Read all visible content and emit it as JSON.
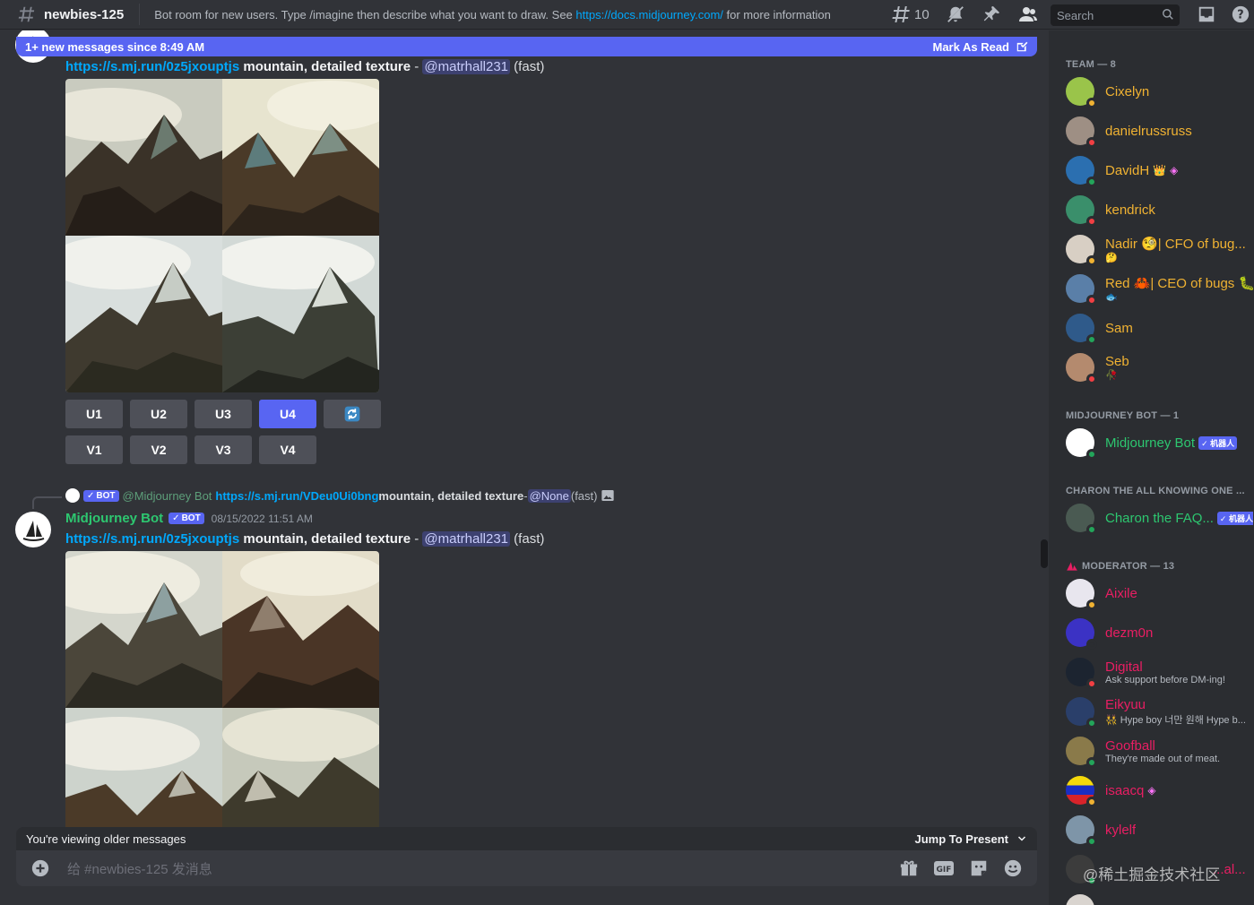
{
  "header": {
    "channel_name": "newbies-125",
    "topic_prefix": "Bot room for new users. Type /imagine then describe what you want to draw. See ",
    "topic_link": "https://docs.midjourney.com/",
    "topic_suffix": " for more information",
    "thread_count": "10",
    "search_placeholder": "Search"
  },
  "new_messages_bar": {
    "text": "1+ new messages since 8:49 AM",
    "action": "Mark As Read"
  },
  "messages": [
    {
      "link": "https://s.mj.run/0z5jxouptjs",
      "prompt": " mountain, detailed texture",
      "sep": " - ",
      "mention": "@matrhall231",
      "speed": " (fast)",
      "upscale_buttons": [
        "U1",
        "U2",
        "U3",
        "U4"
      ],
      "variation_buttons": [
        "V1",
        "V2",
        "V3",
        "V4"
      ]
    },
    {
      "reply": {
        "badge": "BOT",
        "author": "@Midjourney Bot",
        "link": "https://s.mj.run/VDeu0Ui0bng",
        "prompt": " mountain, detailed texture",
        "sep": " - ",
        "mention": "@None",
        "speed": " (fast)"
      },
      "author": "Midjourney Bot",
      "badge": "BOT",
      "timestamp": "08/15/2022 11:51 AM",
      "link": "https://s.mj.run/0z5jxouptjs",
      "prompt": " mountain, detailed texture",
      "sep": " - ",
      "mention": "@matrhall231",
      "speed": " (fast)"
    }
  ],
  "older_bar": {
    "text": "You're viewing older messages",
    "jump": "Jump To Present"
  },
  "composer": {
    "placeholder": "给 #newbies-125 发消息"
  },
  "members": {
    "team_header": "TEAM — 8",
    "team": [
      {
        "name": "Cixelyn",
        "status": "idle",
        "sub": ""
      },
      {
        "name": "danielrussruss",
        "status": "dnd",
        "sub": ""
      },
      {
        "name": "DavidH",
        "status": "online",
        "sub": ""
      },
      {
        "name": "kendrick",
        "status": "dnd",
        "sub": ""
      },
      {
        "name": "Nadir 🧐| CFO of bug...",
        "status": "idle",
        "sub": "🤔"
      },
      {
        "name": "Red 🦀| CEO of bugs 🐛",
        "status": "dnd",
        "sub": "🐟"
      },
      {
        "name": "Sam",
        "status": "online",
        "sub": ""
      },
      {
        "name": "Seb",
        "status": "dnd",
        "sub": "🥀"
      }
    ],
    "bot_header": "MIDJOURNEY BOT — 1",
    "bot": {
      "name": "Midjourney Bot",
      "badge": "✓ 机器人"
    },
    "charon_header": "CHARON THE ALL KNOWING ONE ...",
    "charon": {
      "name": "Charon the FAQ...",
      "badge": "✓ 机器人"
    },
    "mod_header": "MODERATOR — 13",
    "mods": [
      {
        "name": "Aixile",
        "sub": ""
      },
      {
        "name": "dezm0n",
        "sub": ""
      },
      {
        "name": "Digital",
        "sub": "Ask support before DM-ing!"
      },
      {
        "name": "Eikyuu",
        "sub": "👯 Hype boy 너만 원해 Hype b..."
      },
      {
        "name": "Goofball",
        "sub": "They're made out of meat."
      },
      {
        "name": "isaacq",
        "sub": ""
      },
      {
        "name": "kylelf",
        "sub": ""
      }
    ],
    "last_partial": "...al...",
    "watermark": "@稀土掘金技术社区"
  },
  "colors": {
    "accent": "#5865f2",
    "team_name": "#f0b232",
    "bot_name": "#2dc770",
    "mod_name": "#e91e63",
    "link": "#00a8fc"
  }
}
